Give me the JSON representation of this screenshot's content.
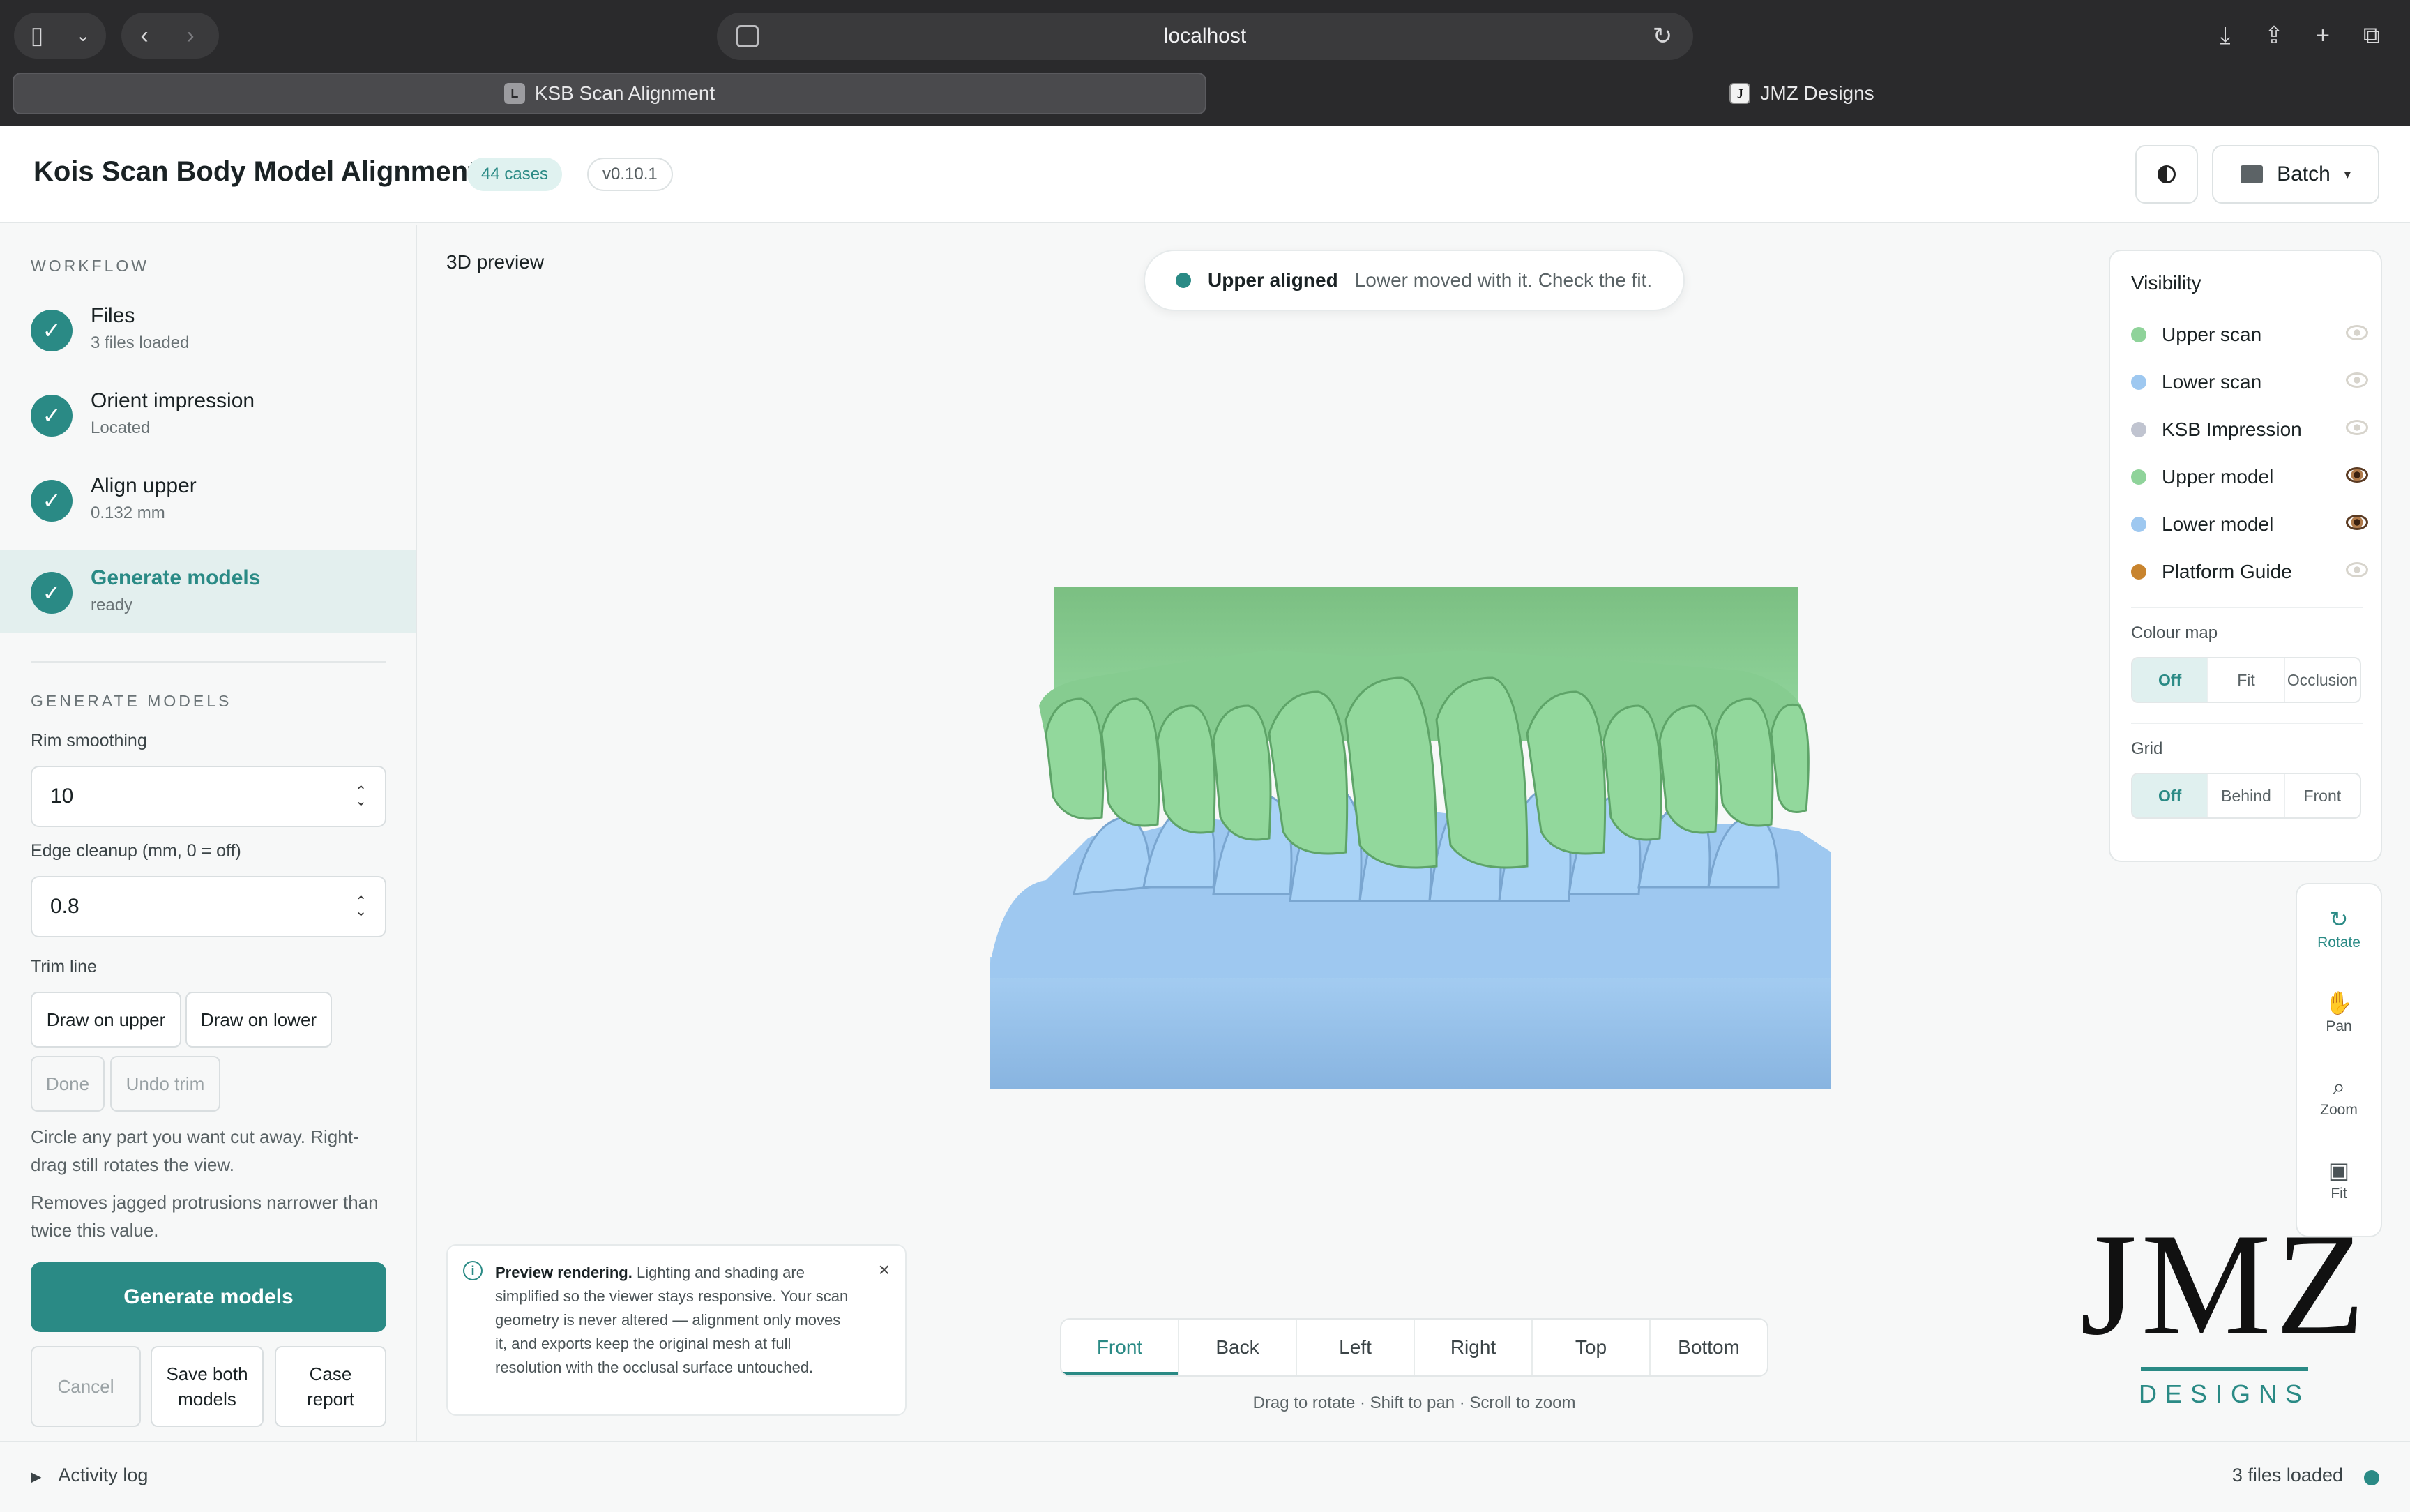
{
  "browser": {
    "url": "localhost",
    "tabs": [
      {
        "label": "KSB Scan Alignment",
        "favicon": "L",
        "active": true
      },
      {
        "label": "JMZ Designs",
        "favicon": "J",
        "active": false
      }
    ]
  },
  "header": {
    "title": "Kois Scan Body Model Alignment",
    "cases_badge": "44 cases",
    "version_badge": "v0.10.1",
    "batch_label": "Batch"
  },
  "workflow": {
    "label": "WORKFLOW",
    "steps": [
      {
        "name": "Files",
        "sub": "3 files loaded"
      },
      {
        "name": "Orient impression",
        "sub": "Located"
      },
      {
        "name": "Align upper",
        "sub": "0.132 mm"
      },
      {
        "name": "Generate models",
        "sub": "ready"
      }
    ]
  },
  "generate": {
    "label": "GENERATE MODELS",
    "rim_label": "Rim smoothing",
    "rim_value": "10",
    "edge_label": "Edge cleanup (mm, 0 = off)",
    "edge_value": "0.8",
    "trim_label": "Trim line",
    "draw_upper": "Draw on upper",
    "draw_lower": "Draw on lower",
    "done": "Done",
    "undo_trim": "Undo trim",
    "help1": "Circle any part you want cut away. Right-drag still rotates the view.",
    "help2": "Removes jagged protrusions narrower than twice this value.",
    "primary": "Generate models",
    "cancel": "Cancel",
    "save_both": "Save both models",
    "case_report": "Case report"
  },
  "viewer": {
    "label": "3D preview",
    "status_strong": "Upper aligned",
    "status_msg": "Lower moved with it. Check the fit.",
    "notice_title": "Preview rendering.",
    "notice_body": "Lighting and shading are simplified so the viewer stays responsive. Your scan geometry is never altered — alignment only moves it, and exports keep the original mesh at full resolution with the occlusal surface untouched.",
    "view_tabs": [
      "Front",
      "Back",
      "Left",
      "Right",
      "Top",
      "Bottom"
    ],
    "active_view": "Front",
    "hint": "Drag to rotate · Shift to pan · Scroll to zoom"
  },
  "visibility": {
    "title": "Visibility",
    "layers": [
      {
        "name": "Upper scan",
        "color": "#8fd39a",
        "visible": false
      },
      {
        "name": "Lower scan",
        "color": "#9ec8f0",
        "visible": false
      },
      {
        "name": "KSB Impression",
        "color": "#c0c4d0",
        "visible": false
      },
      {
        "name": "Upper model",
        "color": "#8fd39a",
        "visible": true
      },
      {
        "name": "Lower model",
        "color": "#9ec8f0",
        "visible": true
      },
      {
        "name": "Platform Guide",
        "color": "#c8842e",
        "visible": false
      }
    ],
    "colour_map_label": "Colour map",
    "colour_map_options": [
      "Off",
      "Fit",
      "Occlusion"
    ],
    "colour_map_active": "Off",
    "grid_label": "Grid",
    "grid_options": [
      "Off",
      "Behind",
      "Front"
    ],
    "grid_active": "Off"
  },
  "tools": [
    {
      "label": "Rotate",
      "icon": "rotate-icon",
      "active": true
    },
    {
      "label": "Pan",
      "icon": "hand-icon",
      "active": false
    },
    {
      "label": "Zoom",
      "icon": "magnifier-icon",
      "active": false
    },
    {
      "label": "Fit",
      "icon": "fit-icon",
      "active": false
    }
  ],
  "logo": {
    "main": "JMZ",
    "sub": "DESIGNS"
  },
  "footer": {
    "activity_log": "Activity log",
    "files_loaded": "3 files loaded"
  },
  "colors": {
    "accent": "#2a8a85",
    "upper_model": "#8fd39a",
    "lower_model": "#9ec8f0"
  }
}
